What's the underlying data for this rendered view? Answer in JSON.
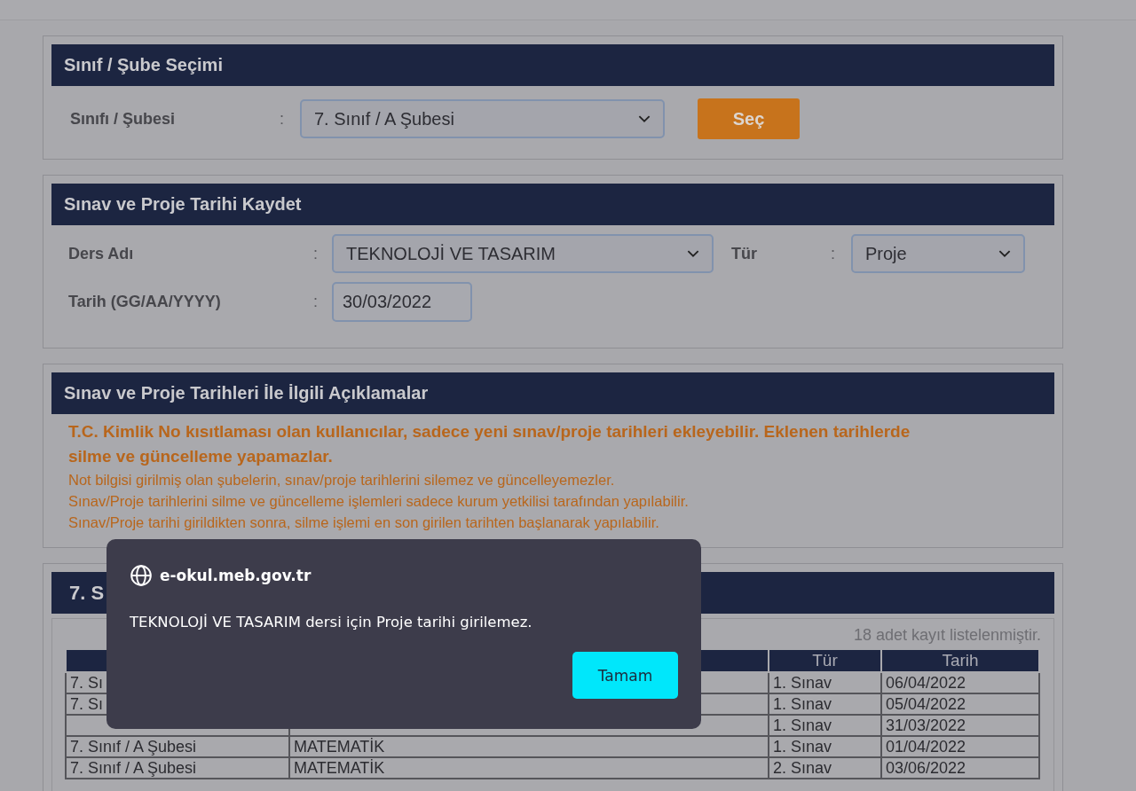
{
  "class_panel": {
    "title": "Sınıf / Şube Seçimi",
    "label": "Sınıfı / Şubesi",
    "separator": ":",
    "select_value": "7. Sınıf / A Şubesi",
    "button": "Seç"
  },
  "save_panel": {
    "title": "Sınav ve Proje Tarihi Kaydet",
    "fields": [
      {
        "label": "Ders Adı",
        "separator": ":",
        "kind": "select",
        "value": "TEKNOLOJİ VE TASARIM"
      },
      {
        "label": "Tür",
        "separator": ":",
        "kind": "select",
        "value": "Proje"
      },
      {
        "label": "Tarih (GG/AA/YYYY)",
        "separator": ":",
        "kind": "input",
        "value": "30/03/2022"
      }
    ]
  },
  "notes_panel": {
    "title": "Sınav ve Proje Tarihleri İle İlgili Açıklamalar",
    "notes": [
      {
        "text": "T.C. Kimlik No kısıtlaması olan kullanıcılar, sadece yeni sınav/proje tarihleri ekleyebilir. Eklenen tarihlerde silme ve güncelleme yapamazlar.",
        "kind": "bold"
      },
      {
        "text": "Not bilgisi girilmiş olan şubelerin, sınav/proje tarihlerini silemez ve güncelleyemezler.",
        "kind": "plain"
      },
      {
        "text": "Sınav/Proje tarihlerini silme ve güncelleme işlemleri sadece kurum yetkilisi tarafından yapılabilir.",
        "kind": "plain"
      },
      {
        "text": "Sınav/Proje tarihi girildikten sonra, silme işlemi en son girilen tarihten başlanarak yapılabilir.",
        "kind": "plain"
      }
    ]
  },
  "list_panel": {
    "title": "7. S",
    "count": "18 adet kayıt listelenmiştir.",
    "table": {
      "columns": [
        "Tür",
        "Tarih"
      ],
      "rows": [
        {
          "column_1": "7. Sı",
          "tur": "1. Sınav",
          "tarih": "06/04/2022"
        },
        {
          "column_1": "7. Sı",
          "tur": "1. Sınav",
          "tarih": "05/04/2022"
        },
        {
          "tur": "1. Sınav",
          "tarih": "31/03/2022"
        },
        {
          "column_1": "7. Sınıf / A Şubesi",
          "column_2": "MATEMATİK",
          "tur": "1. Sınav",
          "tarih": "01/04/2022"
        },
        {
          "column_1": "7. Sınıf / A Şubesi",
          "column_2": "MATEMATİK",
          "tur": "2. Sınav",
          "tarih": "03/06/2022"
        }
      ]
    }
  },
  "dialog": {
    "site": "e-okul.meb.gov.tr",
    "message": "TEKNOLOJİ VE TASARIM dersi için Proje tarihi girilemez.",
    "button": "Tamam"
  }
}
